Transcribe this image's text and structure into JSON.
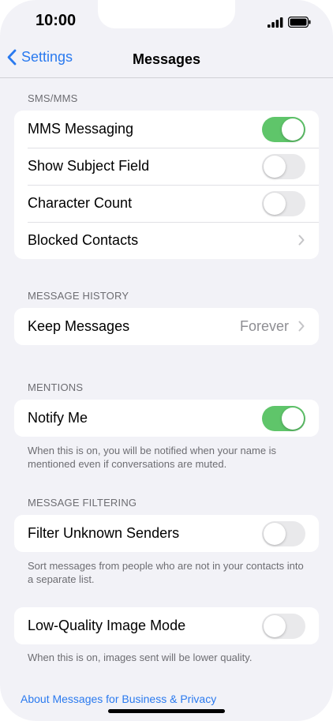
{
  "status_bar": {
    "time": "10:00"
  },
  "nav": {
    "back_label": "Settings",
    "title": "Messages"
  },
  "sections": {
    "sms_mms": {
      "header": "SMS/MMS",
      "mms_messaging": {
        "label": "MMS Messaging",
        "on": true
      },
      "show_subject_field": {
        "label": "Show Subject Field",
        "on": false
      },
      "character_count": {
        "label": "Character Count",
        "on": false
      },
      "blocked_contacts": {
        "label": "Blocked Contacts"
      }
    },
    "message_history": {
      "header": "MESSAGE HISTORY",
      "keep_messages": {
        "label": "Keep Messages",
        "value": "Forever"
      }
    },
    "mentions": {
      "header": "MENTIONS",
      "notify_me": {
        "label": "Notify Me",
        "on": true
      },
      "footnote": "When this is on, you will be notified when your name is mentioned even if conversations are muted."
    },
    "message_filtering": {
      "header": "MESSAGE FILTERING",
      "filter_unknown_senders": {
        "label": "Filter Unknown Senders",
        "on": false
      },
      "footnote": "Sort messages from people who are not in your contacts into a separate list."
    },
    "low_quality": {
      "low_quality_image_mode": {
        "label": "Low-Quality Image Mode",
        "on": false
      },
      "footnote": "When this is on, images sent will be lower quality."
    }
  },
  "about_link": "About Messages for Business & Privacy",
  "colors": {
    "accent": "#2a7aef",
    "switch_on": "#5fc56a",
    "switch_off": "#e9e9eb",
    "background": "#f2f2f7"
  }
}
